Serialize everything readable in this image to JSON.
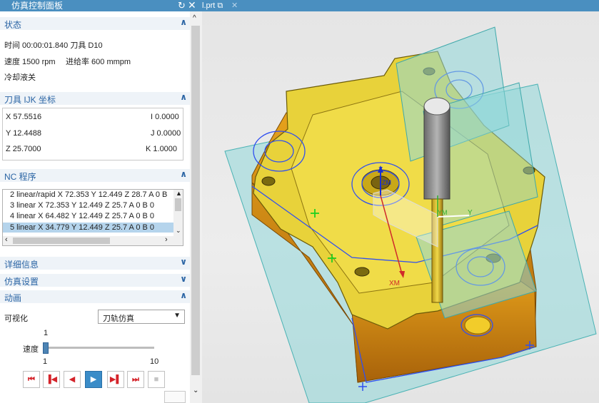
{
  "window": {
    "title": "仿真控制面板",
    "tab_label": "l.prt"
  },
  "sections": {
    "status": {
      "label": "状态",
      "time_line": "时间 00:00:01.840 刀具 D10",
      "speed_text": "速度 1500 rpm",
      "feed_text": "进给率 600 mmpm",
      "coolant_text": "冷却液关"
    },
    "tool_ijk": {
      "label": "刀具 IJK 坐标",
      "x": "X 57.5516",
      "y": "Y 12.4488",
      "z": "Z 25.7000",
      "i": "I 0.0000",
      "j": "J 0.0000",
      "k": "K 1.0000"
    },
    "nc_program": {
      "label": "NC 程序",
      "lines": [
        "2 linear/rapid X 72.353 Y 12.449 Z 28.7 A 0 B",
        "3 linear X 72.353 Y 12.449 Z 25.7 A 0 B 0",
        "4 linear X 64.482 Y 12.449 Z 25.7 A 0 B 0",
        "5 linear X 34.779 Y 12.449 Z 25.7 A 0 B 0"
      ],
      "selected_index": 3
    },
    "details": {
      "label": "详细信息"
    },
    "sim_settings": {
      "label": "仿真设置"
    },
    "animation": {
      "label": "动画",
      "visualization_label": "可视化",
      "visualization_value": "刀轨仿真",
      "speed_label": "速度",
      "speed_value": "1",
      "speed_min": "1",
      "speed_max": "10"
    }
  },
  "viewport": {
    "axis_z": "Z",
    "axis_y": "Y",
    "axis_xm": "XM",
    "axis_ym": "YM",
    "axis_zm": "ZM"
  },
  "colors": {
    "titlebar": "#4a8fc0",
    "section_label": "#2a64a4",
    "part_yellow": "#e8d23a",
    "plane_cyan": "#7fd3d4",
    "toolpath_blue": "#2f4ff0"
  }
}
